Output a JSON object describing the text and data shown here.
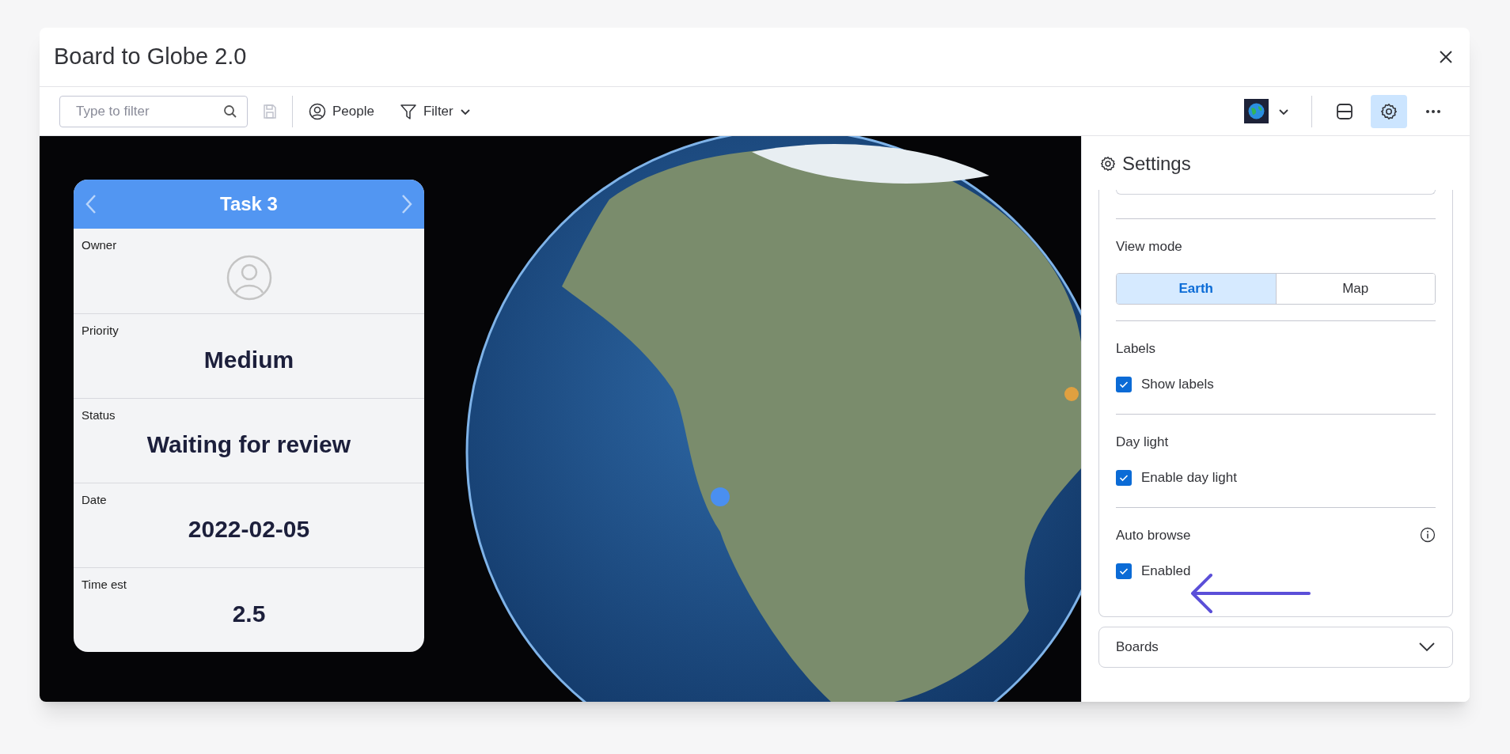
{
  "window": {
    "title": "Board to Globe 2.0"
  },
  "toolbar": {
    "filter": {
      "placeholder": "Type to filter"
    },
    "buttons": [
      {
        "kind": "people",
        "label": "People"
      },
      {
        "kind": "filter",
        "label": "Filter"
      }
    ],
    "settings_selected": true
  },
  "task_card": {
    "title": "Task 3",
    "fields": [
      {
        "kind": "avatar",
        "label": "Owner"
      },
      {
        "kind": "text",
        "label": "Priority",
        "value": "Medium"
      },
      {
        "kind": "text",
        "label": "Status",
        "value": "Waiting for review"
      },
      {
        "kind": "text",
        "label": "Date",
        "value": "2022-02-05"
      },
      {
        "kind": "text",
        "label": "Time est",
        "value": "2.5"
      }
    ]
  },
  "settings": {
    "title": "Settings",
    "view_mode": {
      "label": "View mode",
      "options": [
        {
          "label": "Earth",
          "selected": true
        },
        {
          "label": "Map",
          "selected": false
        }
      ]
    },
    "sections": [
      {
        "label": "Labels",
        "option": "Show labels",
        "checked": true,
        "info": false
      },
      {
        "label": "Day light",
        "option": "Enable day light",
        "checked": true,
        "info": false
      },
      {
        "label": "Auto browse",
        "option": "Enabled",
        "checked": true,
        "info": true
      }
    ],
    "boards": {
      "label": "Boards",
      "expanded": false
    }
  }
}
